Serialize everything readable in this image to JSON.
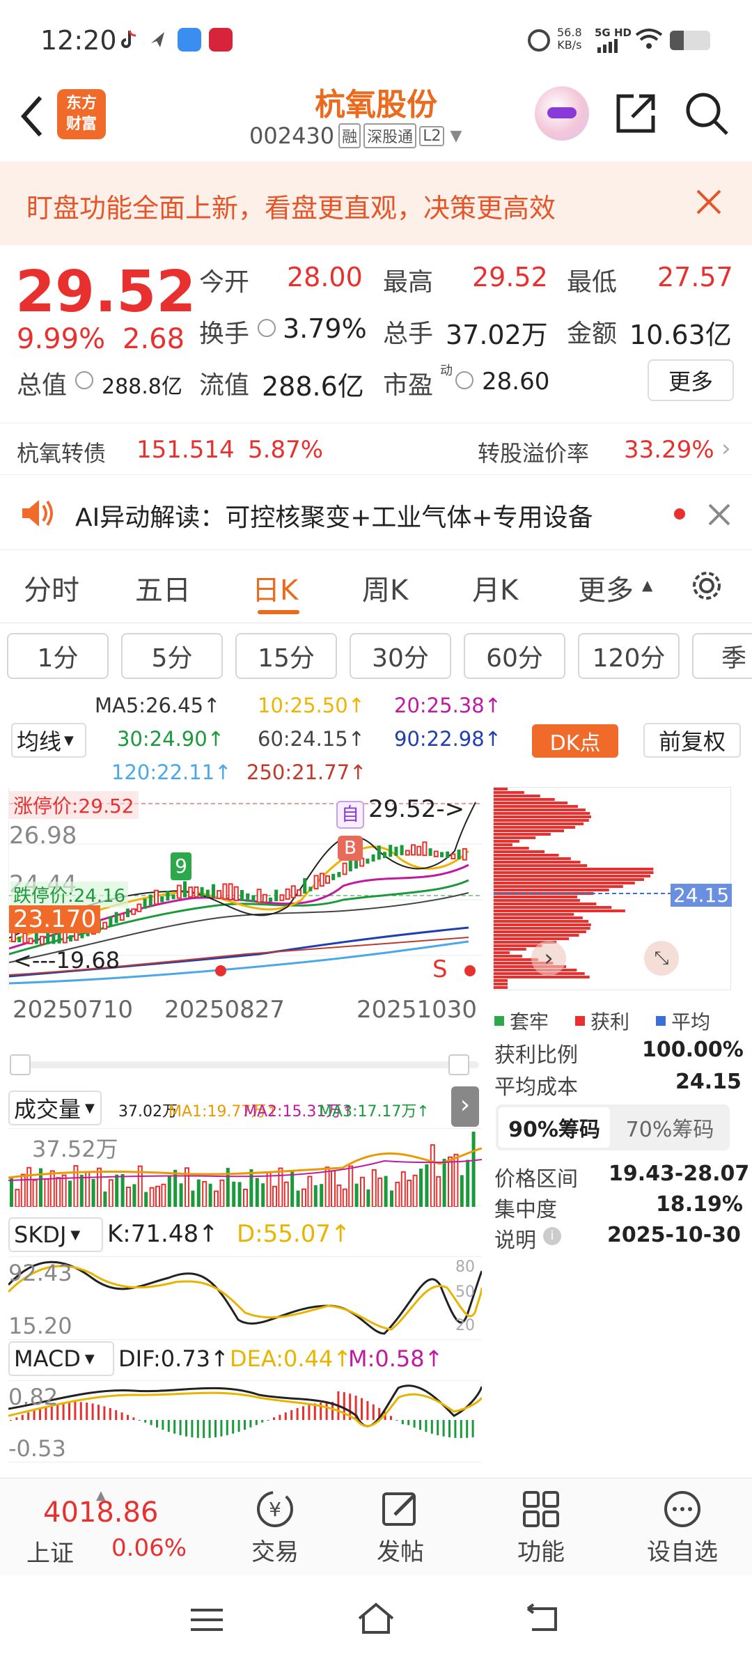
{
  "status": {
    "time": "12:20",
    "net_speed": "56.8",
    "net_unit": "KB/s",
    "signal": "5G HD"
  },
  "header": {
    "brand": "东方\n财富",
    "name": "杭氧股份",
    "code": "002430",
    "tag1": "融",
    "tag2": "深股通",
    "tag3": "L2"
  },
  "banner": {
    "text": "盯盘功能全面上新，看盘更直观，决策更高效"
  },
  "quote": {
    "price": "29.52",
    "change_pct": "9.99%",
    "change": "2.68",
    "open_label": "今开",
    "open": "28.00",
    "high_label": "最高",
    "high": "29.52",
    "low_label": "最低",
    "low": "27.57",
    "turnover_label": "换手",
    "turnover": "3.79%",
    "volume_label": "总手",
    "volume": "37.02万",
    "amount_label": "金额",
    "amount": "10.63亿",
    "mktcap_label": "总值",
    "mktcap": "288.8亿",
    "float_label": "流值",
    "float": "288.6亿",
    "pe_label": "市盈",
    "pe_sup": "动",
    "pe": "28.60",
    "more": "更多"
  },
  "bond": {
    "name": "杭氧转债",
    "price": "151.514",
    "pct": "5.87%",
    "premium_label": "转股溢价率",
    "premium": "33.29%"
  },
  "ai": {
    "text": "AI异动解读：可控核聚变+工业气体+专用设备"
  },
  "period_tabs": [
    "分时",
    "五日",
    "日K",
    "周K",
    "月K",
    "更多"
  ],
  "active_period": "日K",
  "minute_tabs": [
    "1分",
    "5分",
    "15分",
    "30分",
    "60分",
    "120分",
    "季"
  ],
  "ma": {
    "select": "均线",
    "ma5": "MA5:26.45↑",
    "ma10": "10:25.50↑",
    "ma20": "20:25.38↑",
    "ma30": "30:24.90↑",
    "ma60": "60:24.15↑",
    "ma90": "90:22.98↑",
    "ma120": "120:22.11↑",
    "ma250": "250:21.77↑",
    "dk": "DK点",
    "adjust": "前复权",
    "colors": {
      "ma5": "#333333",
      "ma10": "#f0b400",
      "ma20": "#c01aa0",
      "ma30": "#1a9a3a",
      "ma60": "#444444",
      "ma90": "#1f3fb0",
      "ma120": "#4aa8e8",
      "ma250": "#c0392b"
    }
  },
  "kchart": {
    "limit_up": "涨停价:29.52",
    "limit_down": "跌停价:24.16",
    "y1": "26.98",
    "y2": "24.44",
    "current": "23.170",
    "low_mark": "<---19.68",
    "last": "29.52->",
    "tag_self": "自",
    "tag_b": "B",
    "tag_9": "9",
    "tag_s": "S",
    "dates": [
      "20250710",
      "20250827",
      "20251030"
    ]
  },
  "chip": {
    "avg_price": "24.15",
    "legend": [
      "套牢",
      "获利",
      "平均"
    ],
    "profit_label": "获利比例",
    "profit": "100.00%",
    "cost_label": "平均成本",
    "cost": "24.15",
    "tab90": "90%筹码",
    "tab70": "70%筹码",
    "range_label": "价格区间",
    "range": "19.43-28.07",
    "conc_label": "集中度",
    "conc": "18.19%",
    "note_label": "说明",
    "note": "2025-10-30"
  },
  "volume": {
    "select": "成交量",
    "v": "37.02万",
    "ma1": "MA1:19.77万↑",
    "ma2": "MA2:15.31万↑",
    "ma3": "MA3:17.17万↑",
    "max": "37.52万"
  },
  "skdj": {
    "select": "SKDJ",
    "k": "K:71.48↑",
    "d": "D:55.07↑",
    "y1": "92.43",
    "y2": "15.20",
    "r80": "80",
    "r50": "50",
    "r20": "20"
  },
  "macd": {
    "select": "MACD",
    "dif": "DIF:0.73↑",
    "dea": "DEA:0.44↑",
    "m": "M:0.58↑",
    "y1": "0.82",
    "y2": "-0.53"
  },
  "bottom": {
    "index_value": "4018.86",
    "index_name": "上证",
    "index_pct": "0.06%",
    "trade": "交易",
    "post": "发帖",
    "func": "功能",
    "watch": "设自选"
  }
}
